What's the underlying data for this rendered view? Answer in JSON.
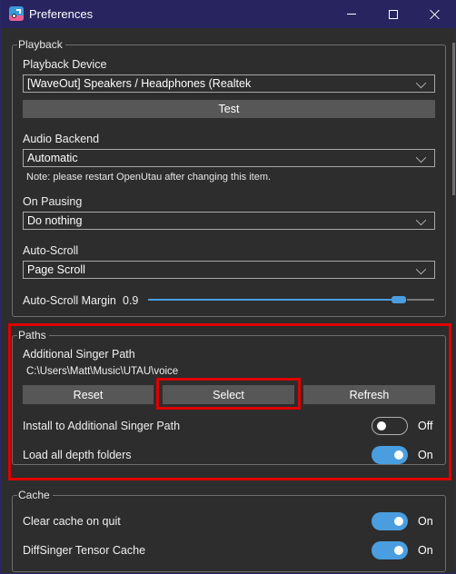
{
  "window": {
    "title": "Preferences",
    "controls": {
      "minimize": "minimize",
      "maximize": "maximize",
      "close": "close"
    }
  },
  "playback": {
    "legend": "Playback",
    "device_label": "Playback Device",
    "device_value": "[WaveOut] Speakers / Headphones (Realtek",
    "test_button": "Test",
    "backend_label": "Audio Backend",
    "backend_value": "Automatic",
    "backend_note": "Note: please restart OpenUtau after changing this item.",
    "pausing_label": "On Pausing",
    "pausing_value": "Do nothing",
    "autoscroll_label": "Auto-Scroll",
    "autoscroll_value": "Page Scroll",
    "margin_label": "Auto-Scroll Margin",
    "margin_value": "0.9",
    "margin_fraction": 0.9
  },
  "paths": {
    "legend": "Paths",
    "singer_path_label": "Additional Singer Path",
    "singer_path_value": "C:\\Users\\Matt\\Music\\UTAU\\voice",
    "reset_button": "Reset",
    "select_button": "Select",
    "refresh_button": "Refresh",
    "install_label": "Install to Additional Singer Path",
    "install_state": "Off",
    "install_on": false,
    "depth_label": "Load all depth folders",
    "depth_state": "On",
    "depth_on": true
  },
  "cache": {
    "legend": "Cache",
    "clear_label": "Clear cache on quit",
    "clear_state": "On",
    "clear_on": true,
    "tensor_label": "DiffSinger Tensor Cache",
    "tensor_state": "On",
    "tensor_on": true
  },
  "colors": {
    "accent": "#4a9ee0",
    "titlebar": "#27245f",
    "highlight": "#e00000"
  }
}
